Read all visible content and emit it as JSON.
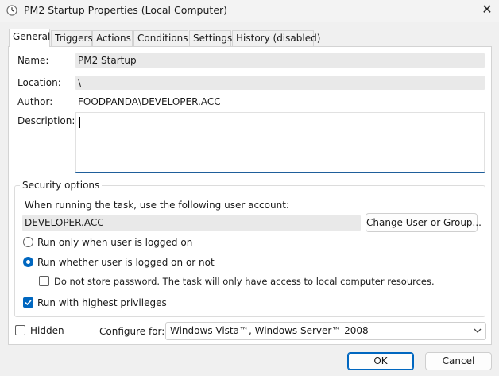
{
  "window": {
    "title": "PM2 Startup Properties (Local Computer)",
    "close_glyph": "✕"
  },
  "tabs": [
    {
      "label": "General",
      "active": true
    },
    {
      "label": "Triggers",
      "active": false
    },
    {
      "label": "Actions",
      "active": false
    },
    {
      "label": "Conditions",
      "active": false
    },
    {
      "label": "Settings",
      "active": false
    },
    {
      "label": "History (disabled)",
      "active": false
    }
  ],
  "general": {
    "name_label": "Name:",
    "name_value": "PM2 Startup",
    "location_label": "Location:",
    "location_value": "\\",
    "author_label": "Author:",
    "author_value": "FOODPANDA\\DEVELOPER.ACC",
    "description_label": "Description:",
    "description_value": ""
  },
  "security": {
    "title": "Security options",
    "account_prompt": "When running the task, use the following user account:",
    "account_value": "DEVELOPER.ACC",
    "change_button": "Change User or Group...",
    "radio_logged_on": "Run only when user is logged on",
    "radio_logged_on_selected": false,
    "radio_whether": "Run whether user is logged on or not",
    "radio_whether_selected": true,
    "do_not_store": "Do not store password.  The task will only have access to local computer resources.",
    "do_not_store_checked": false,
    "highest_privileges": "Run with highest privileges",
    "highest_privileges_checked": true
  },
  "bottom": {
    "hidden_label": "Hidden",
    "hidden_checked": false,
    "configure_label": "Configure for:",
    "configure_value": "Windows Vista™, Windows Server™ 2008"
  },
  "buttons": {
    "ok": "OK",
    "cancel": "Cancel"
  },
  "colors": {
    "accent": "#0067c0",
    "focus_underline": "#1f5f9b",
    "readonly_field": "#e9e9e9"
  }
}
